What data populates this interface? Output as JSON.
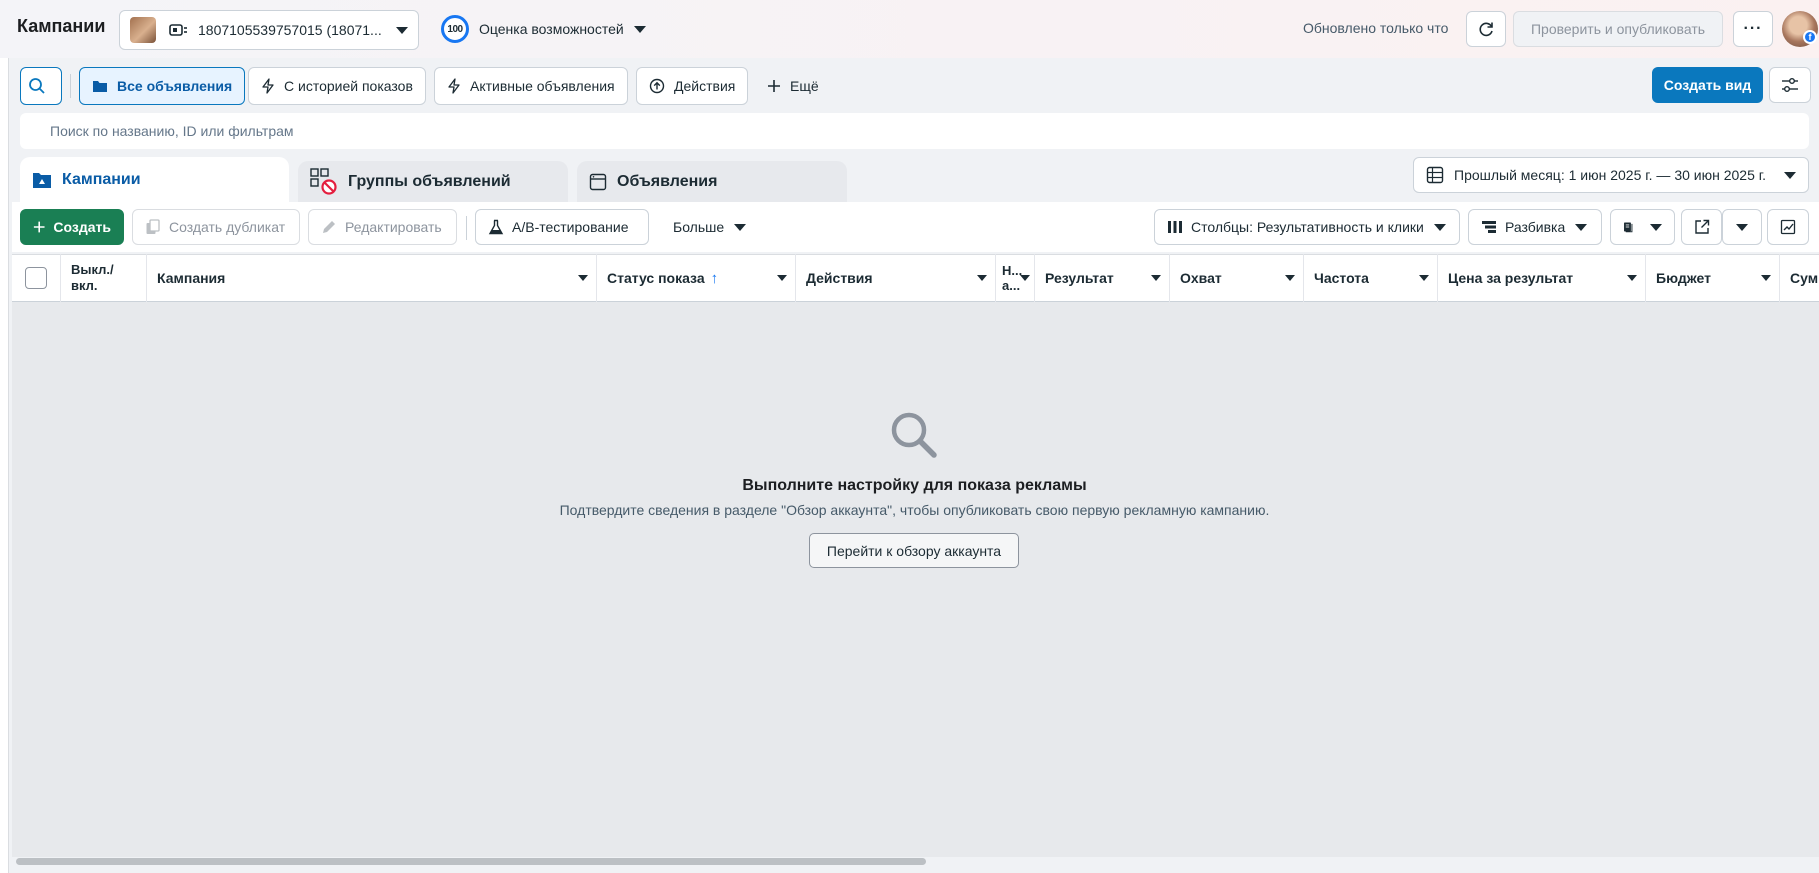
{
  "header": {
    "title": "Кампании",
    "account_label": "1807105539757015 (18071...",
    "score_value": "100",
    "score_label": "Оценка возможностей",
    "updated_text": "Обновлено только что",
    "publish_label": "Проверить и опубликовать",
    "more_options": "···",
    "fb_badge": "f"
  },
  "filters": {
    "chips": [
      "Все объявления",
      "С историей показов",
      "Активные объявления",
      "Действия",
      "Ещё"
    ],
    "create_view_label": "Создать вид",
    "search_placeholder": "Поиск по названию, ID или фильтрам"
  },
  "tabs": {
    "items": [
      "Кампании",
      "Группы объявлений",
      "Объявления"
    ],
    "active": "Кампании",
    "date_range": "Прошлый месяц: 1 июн 2025 г. — 30 июн 2025 г."
  },
  "toolbar": {
    "create_label": "Создать",
    "duplicate_label": "Создать дубликат",
    "edit_label": "Редактировать",
    "ab_test_label": "А/В-тестирование",
    "more_label": "Больше",
    "columns_label": "Столбцы: Результативность и клики",
    "breakdown_label": "Разбивка"
  },
  "table": {
    "columns": [
      "Выкл./ вкл.",
      "Кампания",
      "Статус показа",
      "Действия",
      "Н... а...",
      "Результат",
      "Охват",
      "Частота",
      "Цена за результат",
      "Бюджет",
      "Сум"
    ],
    "sorted_column": "Статус показа",
    "sort_direction": "ascending"
  },
  "empty_state": {
    "title": "Выполните настройку для показа рекламы",
    "description": "Подтвердите сведения в разделе \"Обзор аккаунта\", чтобы опубликовать свою первую рекламную кампанию.",
    "button_label": "Перейти к обзору аккаунта"
  },
  "colors": {
    "primary_blue": "#0a78be",
    "create_green": "#1a7f54",
    "score_ring": "#1877f2",
    "empty_bg": "#e7e9ec",
    "disabled_text": "#8d949e"
  },
  "icons": [
    "search-icon",
    "folder-icon",
    "lightning-icon",
    "upload-circle-icon",
    "plus-icon",
    "sliders-icon",
    "campaign-icon",
    "adset-grid-icon",
    "no-access-icon",
    "ad-window-icon",
    "calendar-table-icon",
    "duplicate-icon",
    "pencil-icon",
    "flask-icon",
    "columns-icon",
    "breakdown-icon",
    "reports-icon",
    "export-icon",
    "chart-icon",
    "magnifier-icon",
    "refresh-icon"
  ]
}
